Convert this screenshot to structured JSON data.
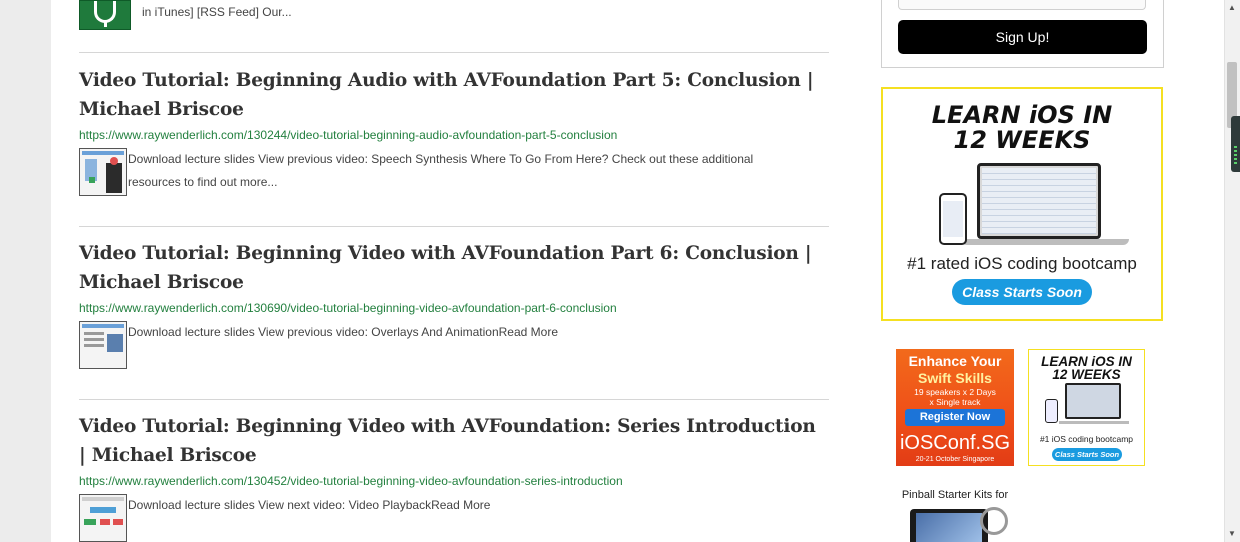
{
  "top_entry": {
    "snippet": "in iTunes] [RSS Feed] Our..."
  },
  "entries": [
    {
      "title": "Video Tutorial: Beginning Audio with AVFoundation Part 5: Conclusion | Michael Briscoe",
      "url": "https://www.raywenderlich.com/130244/video-tutorial-beginning-audio-avfoundation-part-5-conclusion",
      "text": "Download lecture slides View previous video: Speech Synthesis Where To Go From Here? Check out these additional resources to find out more..."
    },
    {
      "title": "Video Tutorial: Beginning Video with AVFoundation Part 6: Conclusion | Michael Briscoe",
      "url": "https://www.raywenderlich.com/130690/video-tutorial-beginning-video-avfoundation-part-6-conclusion",
      "text": "Download lecture slides View previous video: Overlays And AnimationRead More"
    },
    {
      "title": "Video Tutorial: Beginning Video with AVFoundation: Series Introduction | Michael Briscoe",
      "url": "https://www.raywenderlich.com/130452/video-tutorial-beginning-video-avfoundation-series-introduction",
      "text": "Download lecture slides View next video: Video PlaybackRead More"
    }
  ],
  "sidebar": {
    "signup_label": "Sign Up!",
    "ad_bootcamp": {
      "line1": "LEARN iOS IN",
      "line2": "12 WEEKS",
      "subtitle": "#1 rated iOS coding bootcamp",
      "cta": "Class Starts Soon"
    },
    "ad_iosconf": {
      "line1": "Enhance Your",
      "line2": "Swift Skills",
      "line3": "19 speakers x 2 Days",
      "line4": "x Single track",
      "cta": "Register Now",
      "brand": "iOSConf.SG",
      "date": "20-21 October Singapore"
    },
    "ad_bootcamp_small": {
      "line1": "LEARN iOS IN",
      "line2": "12 WEEKS",
      "subtitle": "#1 iOS coding bootcamp",
      "cta": "Class Starts Soon"
    },
    "ad_pinball": {
      "title": "Pinball Starter Kits for"
    }
  },
  "colors": {
    "link_green": "#23803f",
    "ad_border_yellow": "#f5e021",
    "cta_blue": "#1a9be0",
    "conf_orange": "#ef4e18"
  },
  "icons": {
    "podcast": "microphone-icon",
    "scroll_up": "arrow-up-icon",
    "scroll_down": "arrow-down-icon"
  }
}
